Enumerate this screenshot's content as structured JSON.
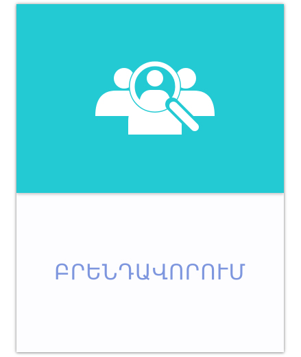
{
  "card": {
    "label": "ԲՐԵՆԴԱՎՈՐՈՒՄ",
    "icon": "people-search-icon",
    "colors": {
      "header_background": "#24cad3",
      "body_background": "#fdfdff",
      "label_text": "#7d96de",
      "icon": "#ffffff"
    }
  }
}
